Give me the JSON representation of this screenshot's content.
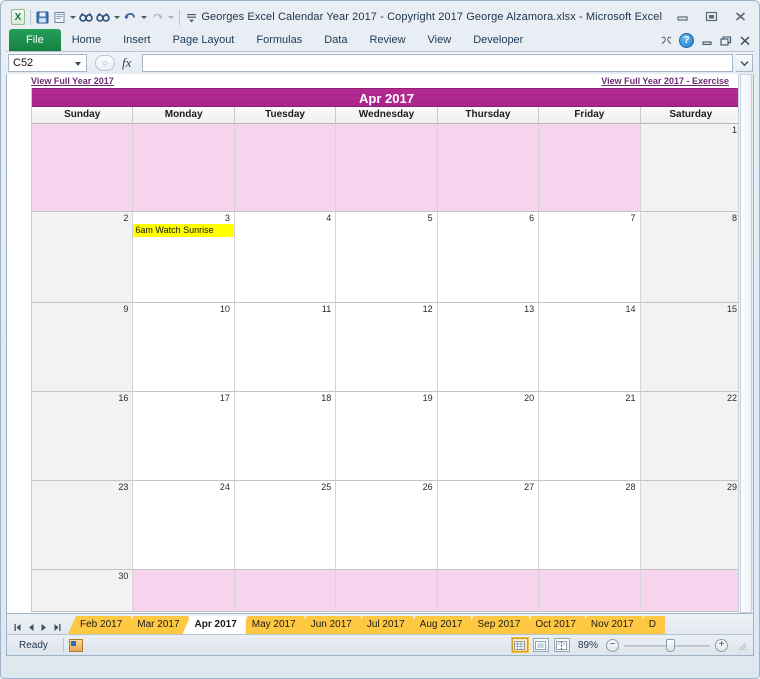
{
  "window": {
    "title": "Georges Excel Calendar Year 2017  -  Copyright 2017 George Alzamora.xlsx  -  Microsoft Excel",
    "minimize_label": "Minimize",
    "maximize_label": "Maximize",
    "close_label": "Close"
  },
  "quick_access": {
    "app_icon": "excel-logo-icon",
    "items": [
      {
        "name": "save-icon",
        "label": "Save"
      },
      {
        "name": "print-preview-icon",
        "label": "Print Preview"
      },
      {
        "name": "spelling-icon",
        "label": "Spelling"
      },
      {
        "name": "research-icon",
        "label": "Research"
      },
      {
        "name": "undo-icon",
        "label": "Undo"
      },
      {
        "name": "redo-icon",
        "label": "Redo"
      },
      {
        "name": "customize-qat-icon",
        "label": "Customize Quick Access Toolbar"
      }
    ]
  },
  "ribbon": {
    "file_tab": "File",
    "tabs": [
      {
        "label": "Home"
      },
      {
        "label": "Insert"
      },
      {
        "label": "Page Layout"
      },
      {
        "label": "Formulas"
      },
      {
        "label": "Data"
      },
      {
        "label": "Review"
      },
      {
        "label": "View"
      },
      {
        "label": "Developer"
      }
    ],
    "help_label": "?",
    "minimize_ribbon_label": "Minimize the Ribbon"
  },
  "formula_bar": {
    "name_box_value": "C52",
    "cancel_label": "Cancel",
    "enter_label": "Enter",
    "function_label": "fx",
    "formula_value": "",
    "formula_placeholder": "",
    "expand_label": "Expand Formula Bar"
  },
  "sheet_links": {
    "left": "View Full Year 2017",
    "right": "View Full Year 2017 - Exercise"
  },
  "calendar": {
    "title": "Apr 2017",
    "title_color": "#b0268f",
    "blank_fill_color": "#f6d4ee",
    "weekend_fill_color": "#f2f2f2",
    "event_fill_color": "#ffff00",
    "weekdays": [
      "Sunday",
      "Monday",
      "Tuesday",
      "Wednesday",
      "Thursday",
      "Friday",
      "Saturday"
    ],
    "weeks": [
      [
        {
          "day": "",
          "blank": true
        },
        {
          "day": "",
          "blank": true
        },
        {
          "day": "",
          "blank": true
        },
        {
          "day": "",
          "blank": true
        },
        {
          "day": "",
          "blank": true
        },
        {
          "day": "",
          "blank": true
        },
        {
          "day": "1",
          "weekend": true
        }
      ],
      [
        {
          "day": "2",
          "weekend": true
        },
        {
          "day": "3",
          "event": "6am Watch Sunrise"
        },
        {
          "day": "4"
        },
        {
          "day": "5"
        },
        {
          "day": "6"
        },
        {
          "day": "7"
        },
        {
          "day": "8",
          "weekend": true
        }
      ],
      [
        {
          "day": "9",
          "weekend": true
        },
        {
          "day": "10"
        },
        {
          "day": "11"
        },
        {
          "day": "12"
        },
        {
          "day": "13"
        },
        {
          "day": "14"
        },
        {
          "day": "15",
          "weekend": true
        }
      ],
      [
        {
          "day": "16",
          "weekend": true
        },
        {
          "day": "17"
        },
        {
          "day": "18"
        },
        {
          "day": "19"
        },
        {
          "day": "20"
        },
        {
          "day": "21"
        },
        {
          "day": "22",
          "weekend": true
        }
      ],
      [
        {
          "day": "23",
          "weekend": true
        },
        {
          "day": "24"
        },
        {
          "day": "25"
        },
        {
          "day": "26"
        },
        {
          "day": "27"
        },
        {
          "day": "28"
        },
        {
          "day": "29",
          "weekend": true
        }
      ],
      [
        {
          "day": "30",
          "weekend": true
        },
        {
          "day": "",
          "blank": true
        },
        {
          "day": "",
          "blank": true
        },
        {
          "day": "",
          "blank": true
        },
        {
          "day": "",
          "blank": true
        },
        {
          "day": "",
          "blank": true
        },
        {
          "day": "",
          "blank": true
        }
      ]
    ]
  },
  "sheet_tabs": {
    "nav": [
      "first-sheet",
      "previous-sheet",
      "next-sheet",
      "last-sheet"
    ],
    "tabs": [
      {
        "label": "Feb 2017",
        "active": false
      },
      {
        "label": "Mar 2017",
        "active": false
      },
      {
        "label": "Apr 2017",
        "active": true
      },
      {
        "label": "May 2017",
        "active": false
      },
      {
        "label": "Jun 2017",
        "active": false
      },
      {
        "label": "Jul 2017",
        "active": false
      },
      {
        "label": "Aug 2017",
        "active": false
      },
      {
        "label": "Sep 2017",
        "active": false
      },
      {
        "label": "Oct 2017",
        "active": false
      },
      {
        "label": "Nov 2017",
        "active": false
      },
      {
        "label": "D",
        "active": false
      }
    ],
    "tab_color": "#ffc843"
  },
  "status_bar": {
    "state": "Ready",
    "macro_icon_label": "Record Macro",
    "views": [
      {
        "name": "normal-view-button",
        "active": true
      },
      {
        "name": "page-layout-view-button",
        "active": false
      },
      {
        "name": "page-break-preview-button",
        "active": false
      }
    ],
    "zoom_level": "89%",
    "zoom_out_label": "−",
    "zoom_in_label": "+"
  }
}
